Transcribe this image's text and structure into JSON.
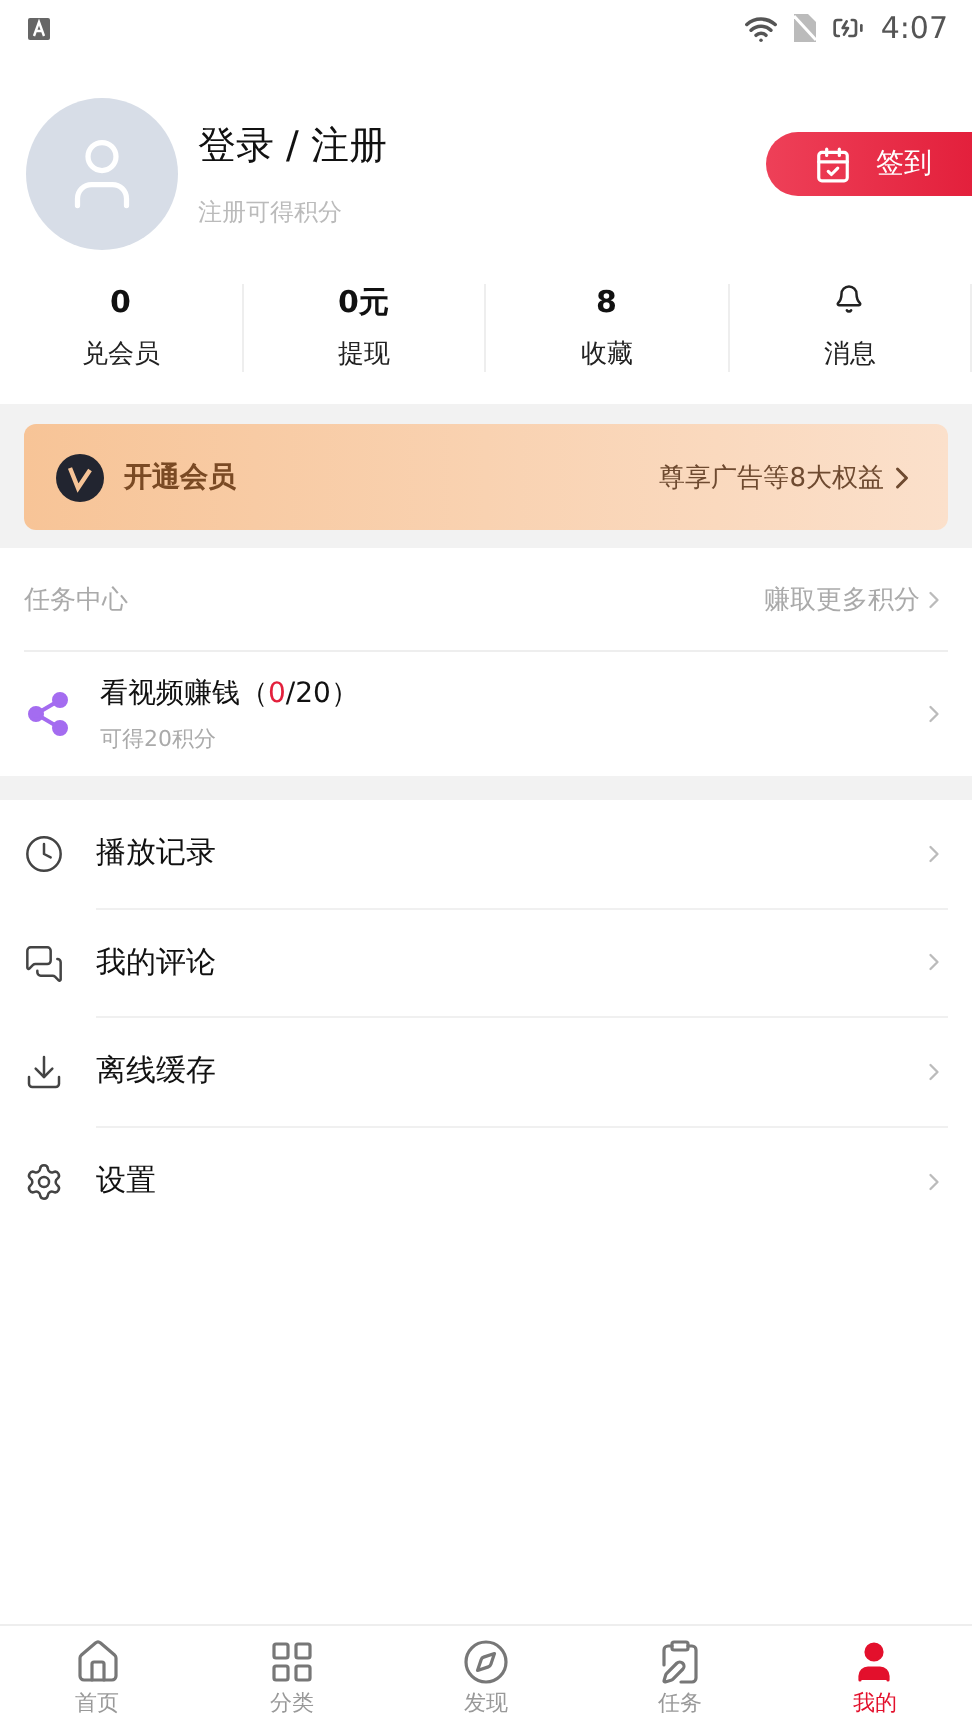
{
  "status_bar": {
    "time": "4:07"
  },
  "profile": {
    "name": "登录 / 注册",
    "hint": "注册可得积分",
    "checkin": "签到"
  },
  "stats": [
    {
      "kind": "value",
      "value": "0",
      "label": "兑会员"
    },
    {
      "kind": "value",
      "value": "0元",
      "label": "提现"
    },
    {
      "kind": "value",
      "value": "8",
      "label": "收藏"
    },
    {
      "kind": "bell",
      "label": "消息"
    }
  ],
  "vip": {
    "title": "开通会员",
    "benefit": "尊享广告等8大权益"
  },
  "task_center": {
    "title": "任务中心",
    "more": "赚取更多积分",
    "tasks": [
      {
        "before": "看视频赚钱（",
        "count": "0",
        "after": "/20）",
        "reward": "可得20积分"
      }
    ]
  },
  "menu": [
    {
      "label": "播放记录"
    },
    {
      "label": "我的评论"
    },
    {
      "label": "离线缓存"
    },
    {
      "label": "设置"
    }
  ],
  "nav": [
    {
      "label": "首页",
      "selected": false
    },
    {
      "label": "分类",
      "selected": false
    },
    {
      "label": "发现",
      "selected": false
    },
    {
      "label": "任务",
      "selected": false
    },
    {
      "label": "我的",
      "selected": true
    }
  ]
}
